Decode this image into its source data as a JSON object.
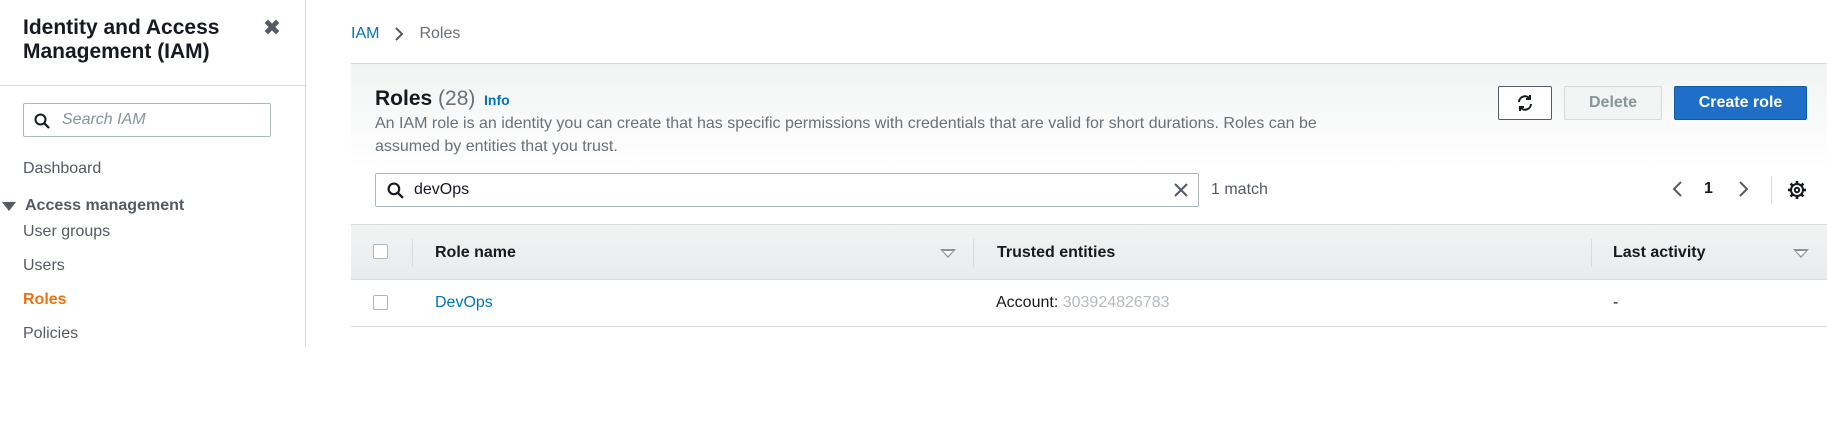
{
  "sidebar": {
    "title": "Identity and Access Management (IAM)",
    "search_placeholder": "Search IAM",
    "dashboard": "Dashboard",
    "section_title": "Access management",
    "items": [
      "User groups",
      "Users",
      "Roles",
      "Policies"
    ],
    "active_item": "Roles"
  },
  "breadcrumb": {
    "root": "IAM",
    "current": "Roles"
  },
  "panel": {
    "title": "Roles",
    "count": "(28)",
    "info": "Info",
    "description": "An IAM role is an identity you can create that has specific permissions with credentials that are valid for short durations. Roles can be assumed by entities that you trust.",
    "delete_label": "Delete",
    "create_label": "Create role",
    "filter_value": "devOps",
    "match_count": "1 match",
    "page": "1"
  },
  "table": {
    "columns": [
      "Role name",
      "Trusted entities",
      "Last activity"
    ],
    "rows": [
      {
        "role_name": "DevOps",
        "trusted_prefix": "Account:",
        "trusted_account": "303924826783",
        "last_activity": "-"
      }
    ]
  },
  "colors": {
    "accent": "#ec7211",
    "link": "#0073bb",
    "primary_button": "#1f6fc8"
  }
}
